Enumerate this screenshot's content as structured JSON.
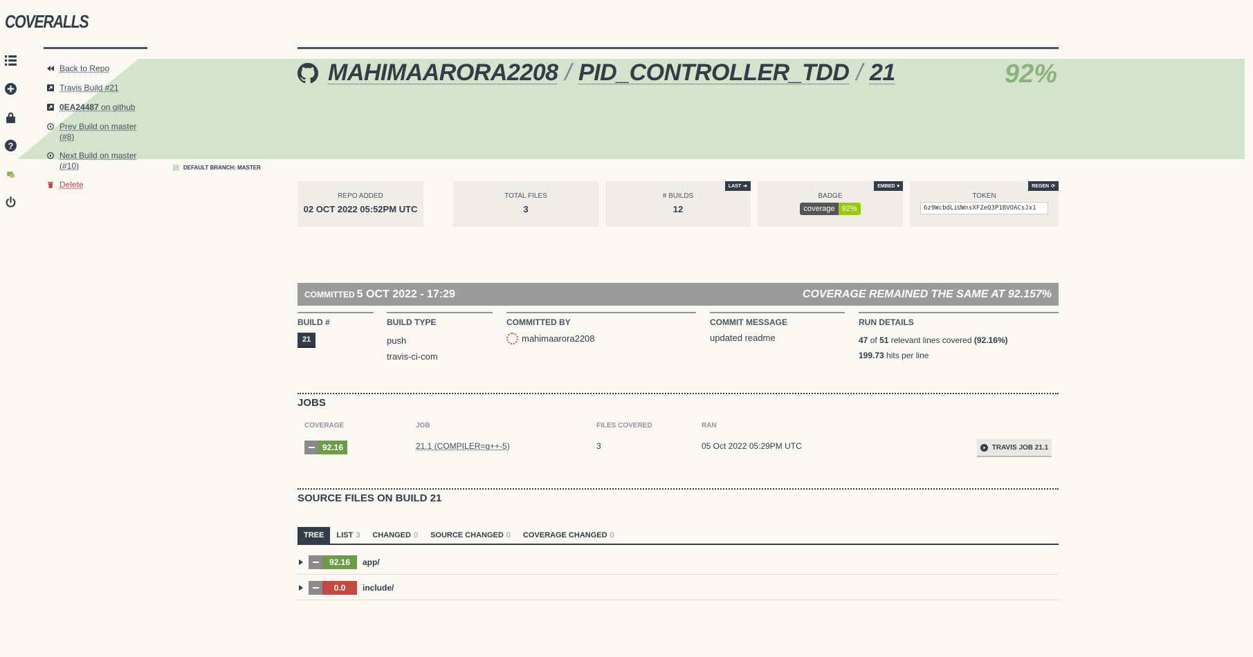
{
  "app": {
    "logo": "COVERALLS"
  },
  "rail": {
    "icons": [
      "list-icon",
      "add-circle-icon",
      "lock-icon",
      "help-icon",
      "user-avatar-icon",
      "power-icon"
    ]
  },
  "nav": {
    "back": "Back to Repo",
    "travis_build": "Travis Build #21",
    "commit_sha": "0EA24487",
    "commit_suffix": " on github",
    "prev_build": "Prev Build on master (#8)",
    "next_build": "Next Build on master (#10)",
    "delete": "Delete"
  },
  "branch": {
    "label": "DEFAULT BRANCH: MASTER"
  },
  "header": {
    "owner": "MAHIMAARORA2208",
    "repo": "PID_CONTROLLER_TDD",
    "build": "21",
    "sep": "/",
    "coverage": "92%"
  },
  "stats": {
    "repo_added": {
      "label": "REPO ADDED",
      "value": "02 OCT 2022 05:52PM UTC"
    },
    "total_files": {
      "label": "TOTAL FILES",
      "value": "3"
    },
    "builds": {
      "label": "# BUILDS",
      "value": "12",
      "tag": "LAST"
    },
    "badge": {
      "label": "BADGE",
      "left": "coverage",
      "right": "92%",
      "tag": "EMBED"
    },
    "token": {
      "label": "TOKEN",
      "value": "6z9WcbdLiUWnsXFZeQ3P1BVOACsJx1",
      "tag": "REGEN"
    }
  },
  "commit": {
    "prefix": "COMMITTED",
    "date": "5 OCT 2022 - 17:29",
    "status": "COVERAGE REMAINED THE SAME AT 92.157%"
  },
  "details": {
    "build_num_label": "BUILD #",
    "build_num": "21",
    "build_type_label": "BUILD TYPE",
    "build_type": "push",
    "service": "travis-ci-com",
    "committed_by_label": "COMMITTED BY",
    "committer": "mahimaarora2208",
    "message_label": "COMMIT MESSAGE",
    "message": "updated readme",
    "run_label": "RUN DETAILS",
    "covered": "47",
    "of": "of",
    "relevant": "51",
    "relevant_text": "relevant lines covered",
    "pct": "(92.16%)",
    "hits": "199.73",
    "hits_text": "hits per line"
  },
  "jobs": {
    "title": "JOBS",
    "headers": {
      "coverage": "COVERAGE",
      "job": "JOB",
      "files": "FILES COVERED",
      "ran": "RAN"
    },
    "rows": [
      {
        "coverage": "92.16",
        "job": "21.1 (COMPILER=g++-5)",
        "files": "3",
        "ran": "05 Oct 2022 05:29PM UTC",
        "button": "TRAVIS JOB 21.1"
      }
    ]
  },
  "source": {
    "title": "SOURCE FILES ON BUILD 21",
    "tabs": [
      {
        "label": "TREE",
        "count": ""
      },
      {
        "label": "LIST",
        "count": "3"
      },
      {
        "label": "CHANGED",
        "count": "0"
      },
      {
        "label": "SOURCE CHANGED",
        "count": "0"
      },
      {
        "label": "COVERAGE CHANGED",
        "count": "0"
      }
    ],
    "files": [
      {
        "coverage": "92.16",
        "name": "app/",
        "color": "#6a9d45"
      },
      {
        "coverage": "0.0",
        "name": "include/",
        "color": "#c44a3f"
      }
    ]
  },
  "colors": {
    "brand_dark": "#333c47",
    "banner": "#d4e3cb",
    "green": "#6a9d45",
    "red": "#c44a3f",
    "delete": "#c24242"
  }
}
